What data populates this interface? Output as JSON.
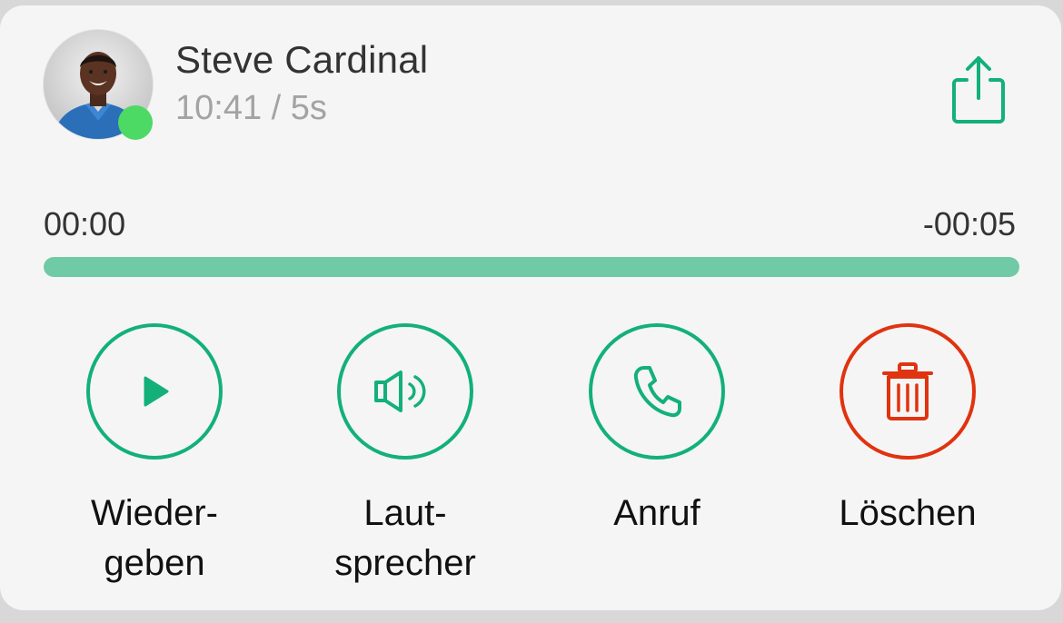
{
  "contact": {
    "name": "Steve Cardinal",
    "meta": "10:41 / 5s",
    "online": true
  },
  "player": {
    "elapsed": "00:00",
    "remaining": "-00:05",
    "progress_fraction": 1.0
  },
  "actions": [
    {
      "label": "Wieder-\ngeben",
      "icon": "play-icon"
    },
    {
      "label": "Laut-\nsprecher",
      "icon": "speaker-icon"
    },
    {
      "label": "Anruf",
      "icon": "phone-icon"
    },
    {
      "label": "Löschen",
      "icon": "trash-icon"
    }
  ],
  "colors": {
    "accent": "#13b07a",
    "progress": "#6fcaa5",
    "danger": "#e0330f",
    "status_online": "#4cd964"
  }
}
